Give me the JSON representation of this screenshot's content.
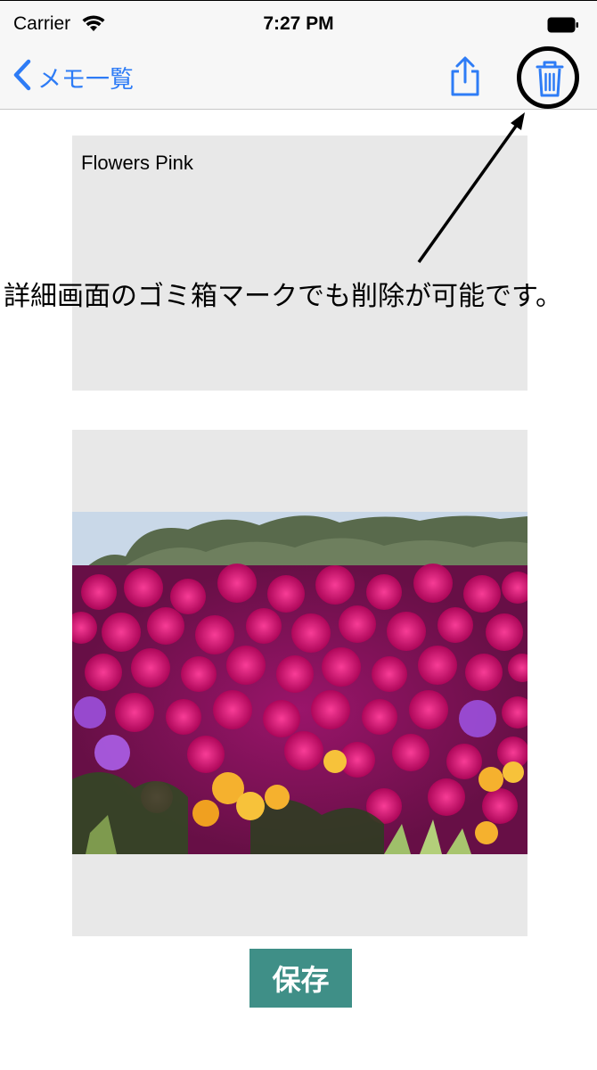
{
  "status_bar": {
    "carrier": "Carrier",
    "time": "7:27 PM",
    "icons": [
      "wifi-icon",
      "battery-icon"
    ]
  },
  "nav_bar": {
    "back_label": "メモ一覧",
    "icons": [
      "chevron-left-icon",
      "share-icon",
      "trash-icon"
    ],
    "accent_color": "#2e7cf6"
  },
  "memo": {
    "text": "Flowers Pink"
  },
  "annotation": {
    "text": "詳細画面のゴミ箱マークでも削除が可能です。"
  },
  "photo": {
    "description_icon": "flower-photo"
  },
  "save_button": {
    "label": "保存",
    "color": "#3f8f87"
  }
}
